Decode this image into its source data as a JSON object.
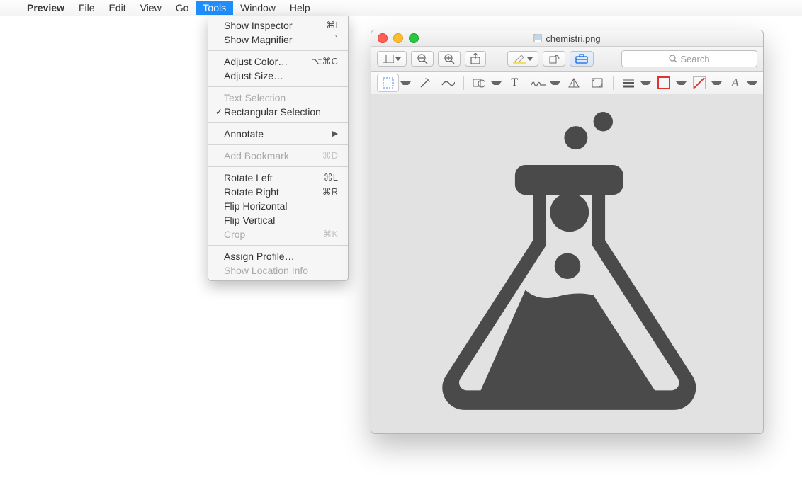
{
  "menubar": {
    "app": "Preview",
    "items": [
      "File",
      "Edit",
      "View",
      "Go",
      "Tools",
      "Window",
      "Help"
    ],
    "open_index": 4
  },
  "tools_menu": {
    "groups": [
      [
        {
          "label": "Show Inspector",
          "shortcut": "⌘I"
        },
        {
          "label": "Show Magnifier",
          "shortcut": "`"
        }
      ],
      [
        {
          "label": "Adjust Color…",
          "shortcut": "⌥⌘C"
        },
        {
          "label": "Adjust Size…",
          "shortcut": ""
        }
      ],
      [
        {
          "label": "Text Selection",
          "shortcut": "",
          "disabled": true
        },
        {
          "label": "Rectangular Selection",
          "shortcut": "",
          "checked": true
        }
      ],
      [
        {
          "label": "Annotate",
          "shortcut": "",
          "submenu": true
        }
      ],
      [
        {
          "label": "Add Bookmark",
          "shortcut": "⌘D",
          "disabled": true
        }
      ],
      [
        {
          "label": "Rotate Left",
          "shortcut": "⌘L"
        },
        {
          "label": "Rotate Right",
          "shortcut": "⌘R"
        },
        {
          "label": "Flip Horizontal",
          "shortcut": ""
        },
        {
          "label": "Flip Vertical",
          "shortcut": ""
        },
        {
          "label": "Crop",
          "shortcut": "⌘K",
          "disabled": true
        }
      ],
      [
        {
          "label": "Assign Profile…",
          "shortcut": ""
        },
        {
          "label": "Show Location Info",
          "shortcut": "",
          "disabled": true
        }
      ]
    ]
  },
  "window": {
    "title": "chemistri.png",
    "search_placeholder": "Search"
  }
}
